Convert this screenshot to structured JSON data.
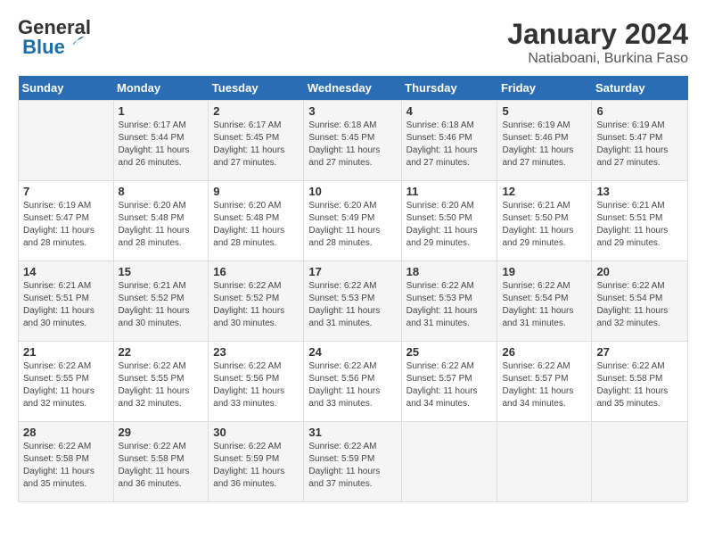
{
  "header": {
    "logo_line1": "General",
    "logo_line2": "Blue",
    "month": "January 2024",
    "location": "Natiaboani, Burkina Faso"
  },
  "days_of_week": [
    "Sunday",
    "Monday",
    "Tuesday",
    "Wednesday",
    "Thursday",
    "Friday",
    "Saturday"
  ],
  "weeks": [
    [
      {
        "day": "",
        "info": ""
      },
      {
        "day": "1",
        "info": "Sunrise: 6:17 AM\nSunset: 5:44 PM\nDaylight: 11 hours\nand 26 minutes."
      },
      {
        "day": "2",
        "info": "Sunrise: 6:17 AM\nSunset: 5:45 PM\nDaylight: 11 hours\nand 27 minutes."
      },
      {
        "day": "3",
        "info": "Sunrise: 6:18 AM\nSunset: 5:45 PM\nDaylight: 11 hours\nand 27 minutes."
      },
      {
        "day": "4",
        "info": "Sunrise: 6:18 AM\nSunset: 5:46 PM\nDaylight: 11 hours\nand 27 minutes."
      },
      {
        "day": "5",
        "info": "Sunrise: 6:19 AM\nSunset: 5:46 PM\nDaylight: 11 hours\nand 27 minutes."
      },
      {
        "day": "6",
        "info": "Sunrise: 6:19 AM\nSunset: 5:47 PM\nDaylight: 11 hours\nand 27 minutes."
      }
    ],
    [
      {
        "day": "7",
        "info": "Sunrise: 6:19 AM\nSunset: 5:47 PM\nDaylight: 11 hours\nand 28 minutes."
      },
      {
        "day": "8",
        "info": "Sunrise: 6:20 AM\nSunset: 5:48 PM\nDaylight: 11 hours\nand 28 minutes."
      },
      {
        "day": "9",
        "info": "Sunrise: 6:20 AM\nSunset: 5:48 PM\nDaylight: 11 hours\nand 28 minutes."
      },
      {
        "day": "10",
        "info": "Sunrise: 6:20 AM\nSunset: 5:49 PM\nDaylight: 11 hours\nand 28 minutes."
      },
      {
        "day": "11",
        "info": "Sunrise: 6:20 AM\nSunset: 5:50 PM\nDaylight: 11 hours\nand 29 minutes."
      },
      {
        "day": "12",
        "info": "Sunrise: 6:21 AM\nSunset: 5:50 PM\nDaylight: 11 hours\nand 29 minutes."
      },
      {
        "day": "13",
        "info": "Sunrise: 6:21 AM\nSunset: 5:51 PM\nDaylight: 11 hours\nand 29 minutes."
      }
    ],
    [
      {
        "day": "14",
        "info": "Sunrise: 6:21 AM\nSunset: 5:51 PM\nDaylight: 11 hours\nand 30 minutes."
      },
      {
        "day": "15",
        "info": "Sunrise: 6:21 AM\nSunset: 5:52 PM\nDaylight: 11 hours\nand 30 minutes."
      },
      {
        "day": "16",
        "info": "Sunrise: 6:22 AM\nSunset: 5:52 PM\nDaylight: 11 hours\nand 30 minutes."
      },
      {
        "day": "17",
        "info": "Sunrise: 6:22 AM\nSunset: 5:53 PM\nDaylight: 11 hours\nand 31 minutes."
      },
      {
        "day": "18",
        "info": "Sunrise: 6:22 AM\nSunset: 5:53 PM\nDaylight: 11 hours\nand 31 minutes."
      },
      {
        "day": "19",
        "info": "Sunrise: 6:22 AM\nSunset: 5:54 PM\nDaylight: 11 hours\nand 31 minutes."
      },
      {
        "day": "20",
        "info": "Sunrise: 6:22 AM\nSunset: 5:54 PM\nDaylight: 11 hours\nand 32 minutes."
      }
    ],
    [
      {
        "day": "21",
        "info": "Sunrise: 6:22 AM\nSunset: 5:55 PM\nDaylight: 11 hours\nand 32 minutes."
      },
      {
        "day": "22",
        "info": "Sunrise: 6:22 AM\nSunset: 5:55 PM\nDaylight: 11 hours\nand 32 minutes."
      },
      {
        "day": "23",
        "info": "Sunrise: 6:22 AM\nSunset: 5:56 PM\nDaylight: 11 hours\nand 33 minutes."
      },
      {
        "day": "24",
        "info": "Sunrise: 6:22 AM\nSunset: 5:56 PM\nDaylight: 11 hours\nand 33 minutes."
      },
      {
        "day": "25",
        "info": "Sunrise: 6:22 AM\nSunset: 5:57 PM\nDaylight: 11 hours\nand 34 minutes."
      },
      {
        "day": "26",
        "info": "Sunrise: 6:22 AM\nSunset: 5:57 PM\nDaylight: 11 hours\nand 34 minutes."
      },
      {
        "day": "27",
        "info": "Sunrise: 6:22 AM\nSunset: 5:58 PM\nDaylight: 11 hours\nand 35 minutes."
      }
    ],
    [
      {
        "day": "28",
        "info": "Sunrise: 6:22 AM\nSunset: 5:58 PM\nDaylight: 11 hours\nand 35 minutes."
      },
      {
        "day": "29",
        "info": "Sunrise: 6:22 AM\nSunset: 5:58 PM\nDaylight: 11 hours\nand 36 minutes."
      },
      {
        "day": "30",
        "info": "Sunrise: 6:22 AM\nSunset: 5:59 PM\nDaylight: 11 hours\nand 36 minutes."
      },
      {
        "day": "31",
        "info": "Sunrise: 6:22 AM\nSunset: 5:59 PM\nDaylight: 11 hours\nand 37 minutes."
      },
      {
        "day": "",
        "info": ""
      },
      {
        "day": "",
        "info": ""
      },
      {
        "day": "",
        "info": ""
      }
    ]
  ]
}
